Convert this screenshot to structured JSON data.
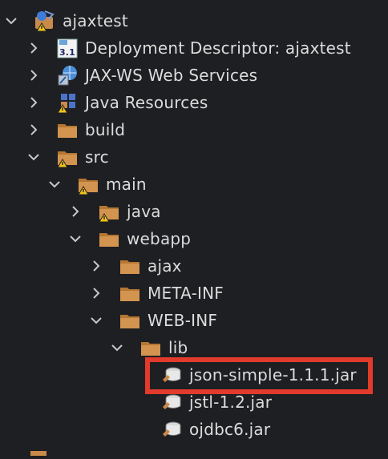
{
  "tree": {
    "rows": [
      {
        "label": "ajaxtest",
        "icon": "web-project-warning-icon",
        "expanded": true
      },
      {
        "label": "Deployment Descriptor: ajaxtest",
        "icon": "deployment-descriptor-icon",
        "expanded": false
      },
      {
        "label": "JAX-WS Web Services",
        "icon": "web-services-icon",
        "expanded": false
      },
      {
        "label": "Java Resources",
        "icon": "java-resources-warning-icon",
        "expanded": false
      },
      {
        "label": "build",
        "icon": "folder-icon",
        "expanded": false
      },
      {
        "label": "src",
        "icon": "folder-warning-icon",
        "expanded": true
      },
      {
        "label": "main",
        "icon": "folder-warning-icon",
        "expanded": true
      },
      {
        "label": "java",
        "icon": "folder-warning-icon",
        "expanded": false
      },
      {
        "label": "webapp",
        "icon": "folder-icon",
        "expanded": true
      },
      {
        "label": "ajax",
        "icon": "folder-icon",
        "expanded": false
      },
      {
        "label": "META-INF",
        "icon": "folder-icon",
        "expanded": false
      },
      {
        "label": "WEB-INF",
        "icon": "folder-icon",
        "expanded": true
      },
      {
        "label": "lib",
        "icon": "folder-icon",
        "expanded": true
      },
      {
        "label": "json-simple-1.1.1.jar",
        "icon": "jar-icon",
        "selected_highlight": true
      },
      {
        "label": "jstl-1.2.jar",
        "icon": "jar-icon"
      },
      {
        "label": "ojdbc6.jar",
        "icon": "jar-icon"
      }
    ]
  },
  "colors": {
    "background": "#1e1f22",
    "text": "#dcdcdc",
    "folder": "#c98a4a",
    "warning": "#f0c419",
    "highlight_border": "#e23a2c"
  }
}
